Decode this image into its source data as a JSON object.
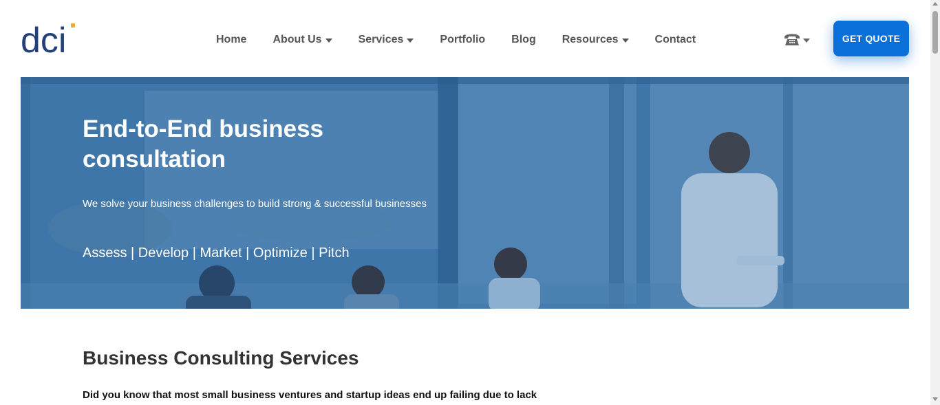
{
  "header": {
    "logo_text": "dci",
    "nav": [
      {
        "label": "Home",
        "has_dropdown": false
      },
      {
        "label": "About Us",
        "has_dropdown": true
      },
      {
        "label": "Services",
        "has_dropdown": true
      },
      {
        "label": "Portfolio",
        "has_dropdown": false
      },
      {
        "label": "Blog",
        "has_dropdown": false
      },
      {
        "label": "Resources",
        "has_dropdown": true
      },
      {
        "label": "Contact",
        "has_dropdown": false
      }
    ],
    "phone_icon": "phone-icon",
    "quote_button": "GET QUOTE"
  },
  "hero": {
    "title": "End-to-End business consultation",
    "subtitle": "We solve your business challenges to build strong & successful businesses",
    "pillars": "Assess | Develop | Market | Optimize | Pitch"
  },
  "section": {
    "title": "Business Consulting Services",
    "text": "Did you know that most small business ventures and startup ideas end up failing due to lack"
  },
  "colors": {
    "accent": "#0a6fd8",
    "logo_blue": "#23407a",
    "logo_dot": "#f2a93b",
    "hero_overlay": "#3f78a8"
  }
}
